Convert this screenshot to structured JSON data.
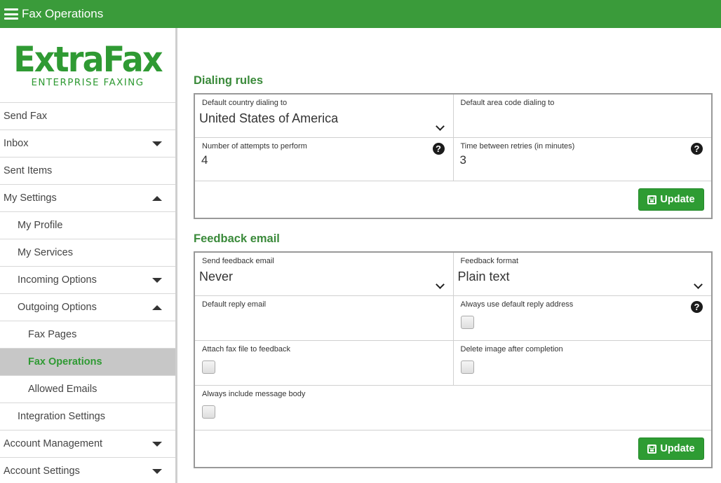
{
  "header": {
    "title": "Fax Operations"
  },
  "logo": {
    "main": "ExtraFax",
    "sub": "ENTERPRISE FAXING"
  },
  "sidebar": {
    "items": [
      {
        "label": "Send Fax"
      },
      {
        "label": "Inbox"
      },
      {
        "label": "Sent Items"
      },
      {
        "label": "My Settings"
      },
      {
        "label": "My Profile"
      },
      {
        "label": "My Services"
      },
      {
        "label": "Incoming Options"
      },
      {
        "label": "Outgoing Options"
      },
      {
        "label": "Fax Pages"
      },
      {
        "label": "Fax Operations"
      },
      {
        "label": "Allowed Emails"
      },
      {
        "label": "Integration Settings"
      },
      {
        "label": "Account Management"
      },
      {
        "label": "Account Settings"
      }
    ]
  },
  "dialing": {
    "title": "Dialing rules",
    "country_label": "Default country dialing to",
    "country_value": "United States of America",
    "area_label": "Default area code dialing to",
    "area_value": "",
    "attempts_label": "Number of attempts to perform",
    "attempts_value": "4",
    "retry_label": "Time between retries (in minutes)",
    "retry_value": "3",
    "update_label": "Update"
  },
  "feedback": {
    "title": "Feedback email",
    "send_label": "Send feedback email",
    "send_value": "Never",
    "format_label": "Feedback format",
    "format_value": "Plain text",
    "reply_label": "Default reply email",
    "reply_value": "",
    "always_reply_label": "Always use default reply address",
    "always_reply_checked": false,
    "attach_label": "Attach fax file to feedback",
    "attach_checked": false,
    "delete_label": "Delete image after completion",
    "delete_checked": false,
    "body_label": "Always include message body",
    "body_checked": false,
    "update_label": "Update"
  },
  "icons": {
    "help": "question-circle-icon",
    "save": "floppy-disk-icon",
    "menu": "hamburger-icon"
  },
  "colors": {
    "brand": "#3a9b3a",
    "button": "#2e9c33",
    "active_bg": "#c7c7c7"
  }
}
